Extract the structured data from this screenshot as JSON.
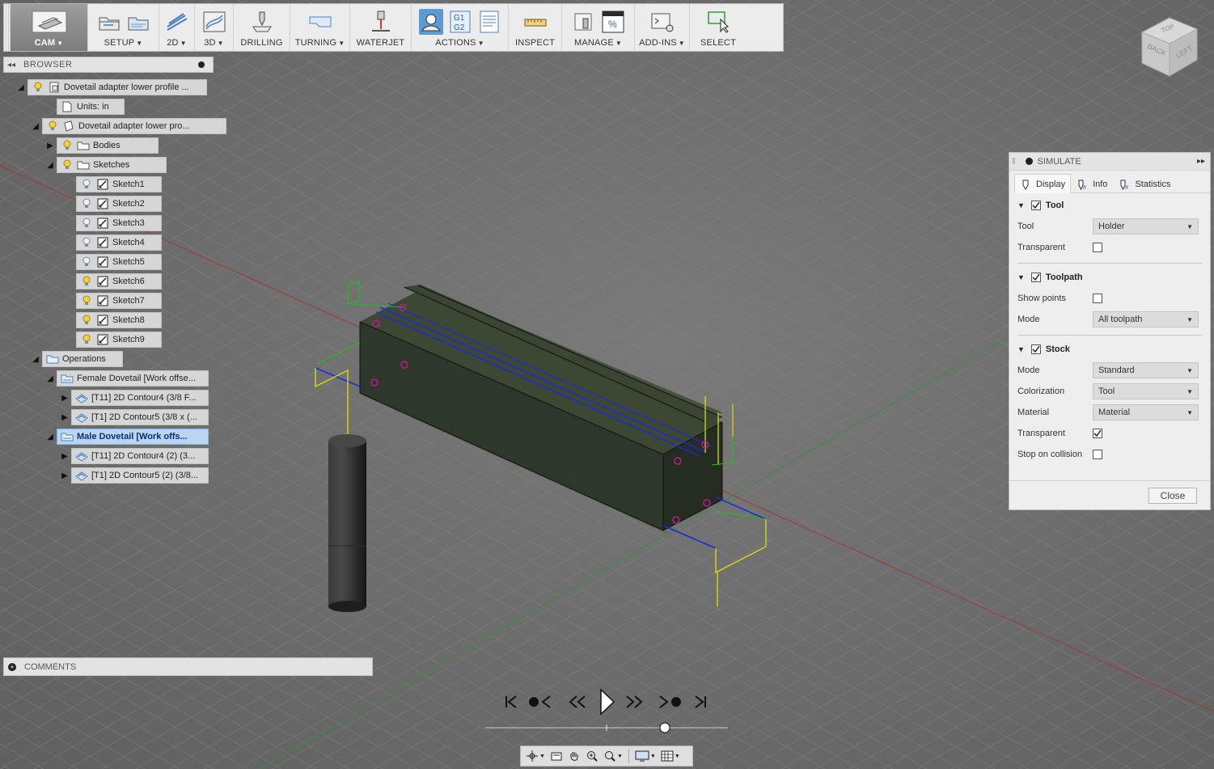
{
  "toolbar": {
    "workspace": "CAM",
    "groups": [
      {
        "id": "setup",
        "label": "SETUP",
        "dropdown": true
      },
      {
        "id": "2d",
        "label": "2D",
        "dropdown": true
      },
      {
        "id": "3d",
        "label": "3D",
        "dropdown": true
      },
      {
        "id": "drilling",
        "label": "DRILLING",
        "dropdown": false
      },
      {
        "id": "turning",
        "label": "TURNING",
        "dropdown": true
      },
      {
        "id": "waterjet",
        "label": "WATERJET",
        "dropdown": false
      },
      {
        "id": "actions",
        "label": "ACTIONS",
        "dropdown": true,
        "icon_text_g1": "G1",
        "icon_text_g2": "G2"
      },
      {
        "id": "inspect",
        "label": "INSPECT",
        "dropdown": false
      },
      {
        "id": "manage",
        "label": "MANAGE",
        "dropdown": true,
        "icon_text": "%"
      },
      {
        "id": "addins",
        "label": "ADD-INS",
        "dropdown": true
      },
      {
        "id": "select",
        "label": "SELECT",
        "dropdown": false
      }
    ]
  },
  "browser": {
    "title": "BROWSER",
    "nodes": [
      {
        "label": "Dovetail adapter lower profile ...",
        "icon": "document-icon",
        "bulb": true
      },
      {
        "label": "Units: in",
        "icon": "page-icon",
        "bulb": false
      },
      {
        "label": "Dovetail adapter lower pro...",
        "icon": "component-icon",
        "bulb": true
      },
      {
        "label": "Bodies",
        "icon": "folder-icon",
        "bulb": true
      },
      {
        "label": "Sketches",
        "icon": "folder-icon",
        "bulb": true
      },
      {
        "label": "Sketch1",
        "icon": "sketch-icon",
        "bulb": true,
        "bulb_on": false
      },
      {
        "label": "Sketch2",
        "icon": "sketch-icon",
        "bulb": true,
        "bulb_on": false
      },
      {
        "label": "Sketch3",
        "icon": "sketch-icon",
        "bulb": true,
        "bulb_on": false
      },
      {
        "label": "Sketch4",
        "icon": "sketch-icon",
        "bulb": true,
        "bulb_on": false
      },
      {
        "label": "Sketch5",
        "icon": "sketch-icon",
        "bulb": true,
        "bulb_on": false
      },
      {
        "label": "Sketch6",
        "icon": "sketch-icon",
        "bulb": true,
        "bulb_on": true
      },
      {
        "label": "Sketch7",
        "icon": "sketch-icon",
        "bulb": true,
        "bulb_on": true
      },
      {
        "label": "Sketch8",
        "icon": "sketch-icon",
        "bulb": true,
        "bulb_on": true
      },
      {
        "label": "Sketch9",
        "icon": "sketch-icon",
        "bulb": true,
        "bulb_on": true
      },
      {
        "label": "Operations",
        "icon": "operations-icon",
        "bulb": false
      },
      {
        "label": "Female Dovetail [Work offse...",
        "icon": "setup-icon",
        "bulb": false
      },
      {
        "label": "[T11] 2D Contour4 (3/8 F...",
        "icon": "contour-icon",
        "bulb": false
      },
      {
        "label": "[T1] 2D Contour5 (3/8 x (...",
        "icon": "contour-icon",
        "bulb": false
      },
      {
        "label": "Male Dovetail [Work offs...",
        "icon": "setup-icon",
        "bulb": false,
        "selected": true
      },
      {
        "label": "[T11] 2D Contour4 (2) (3...",
        "icon": "contour-icon",
        "bulb": false
      },
      {
        "label": "[T1] 2D Contour5 (2) (3/8...",
        "icon": "contour-icon",
        "bulb": false
      }
    ]
  },
  "comments": {
    "title": "COMMENTS"
  },
  "viewcube": {
    "faces": [
      "TOP",
      "BACK",
      "LEFT"
    ]
  },
  "simulate": {
    "title": "SIMULATE",
    "tabs": [
      "Display",
      "Info",
      "Statistics"
    ],
    "active_tab": "Display",
    "tool": {
      "title": "Tool",
      "enabled": true,
      "tool_label": "Tool",
      "tool_value": "Holder",
      "transparent_label": "Transparent",
      "transparent": false
    },
    "toolpath": {
      "title": "Toolpath",
      "enabled": true,
      "show_points_label": "Show points",
      "show_points": false,
      "mode_label": "Mode",
      "mode_value": "All toolpath"
    },
    "stock": {
      "title": "Stock",
      "enabled": true,
      "mode_label": "Mode",
      "mode_value": "Standard",
      "colorization_label": "Colorization",
      "colorization_value": "Tool",
      "material_label": "Material",
      "material_value": "Material",
      "transparent_label": "Transparent",
      "transparent": true,
      "stop_label": "Stop on collision",
      "stop_on_collision": false
    },
    "close_label": "Close"
  },
  "playback": {
    "timeline_position": 0.74
  },
  "colors": {
    "stock": "#2f3a2a",
    "toolpath_blue": "#1a2bd6",
    "toolpath_yellow": "#e8e800",
    "lead_green": "#1fbf1f",
    "markers_pink": "#c01890",
    "axis_red": "#9c3a3a",
    "axis_green": "#3a8f3a",
    "selection_blue": "#b8d6f3"
  }
}
